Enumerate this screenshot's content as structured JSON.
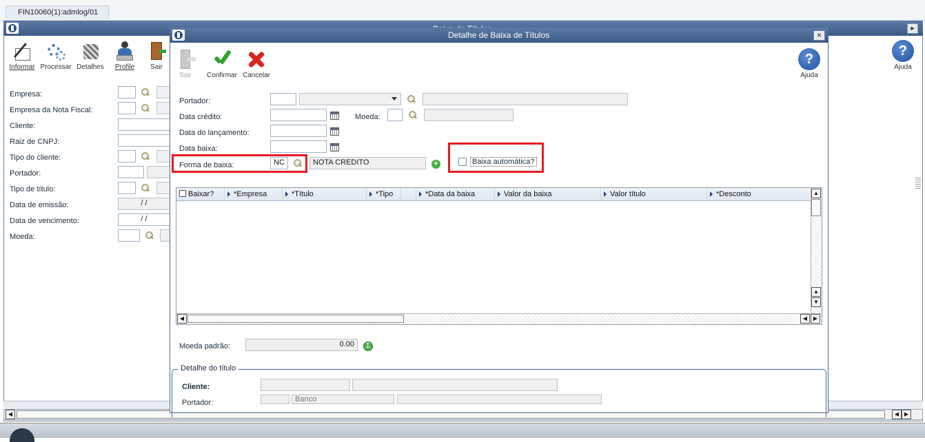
{
  "tab": {
    "title": "FIN10060(1):admlog/01"
  },
  "main_window": {
    "title": "Baixa de Títulos"
  },
  "main_toolbar": {
    "informar": "Informar",
    "processar": "Processar",
    "detalhes": "Detalhes",
    "profile": "Profile",
    "sair": "Sair",
    "ajuda": "Ajuda"
  },
  "main_form": {
    "labels": [
      "Empresa:",
      "Empresa da Nota Fiscal:",
      "Cliente:",
      "Raiz de CNPJ:",
      "Tipo do cliente:",
      "Portador:",
      "Tipo de título:",
      "Data de emissão:",
      "Data de vencimento:",
      "Moeda:"
    ],
    "date_placeholder": "/  /"
  },
  "dialog": {
    "title": "Detalhe de Baixa de Títulos",
    "close": "×",
    "toolbar": {
      "sair": "Sair",
      "confirmar": "Confirmar",
      "cancelar": "Cancelar",
      "ajuda": "Ajuda"
    },
    "form": {
      "portador_label": "Portador:",
      "data_credito_label": "Data crédito:",
      "moeda_label": "Moeda:",
      "data_lancamento_label": "Data do lançamento:",
      "data_baixa_label": "Data baixa:",
      "forma_baixa_label": "Forma de  baixa:",
      "forma_baixa_code": "NC",
      "forma_baixa_desc": "NOTA CREDITO",
      "baixa_automatica_label": "Baixa automática?"
    },
    "grid": {
      "columns": [
        "Baixar?",
        "*Empresa",
        "*Título",
        "*Tipo",
        "",
        "*Data da baixa",
        "Valor da baixa",
        "Valor título",
        "*Desconto"
      ]
    },
    "moeda_padrao_label": "Moeda padrão:",
    "moeda_padrao_value": "0.00",
    "detalhe_titulo_legend": "Detalhe do título",
    "cliente_label": "Cliente:",
    "portador_label2": "Portador:",
    "banco_value": "Banco"
  },
  "colors": {
    "titlebar": "#3c5a86",
    "highlight": "#e51c23"
  }
}
